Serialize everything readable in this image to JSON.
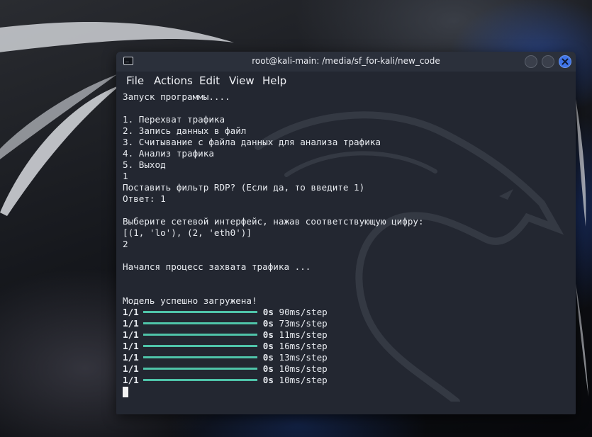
{
  "window": {
    "title": "root@kali-main: /media/sf_for-kali/new_code",
    "app_icon": "terminal-icon"
  },
  "menu": [
    "File",
    "Actions",
    "Edit",
    "View",
    "Help"
  ],
  "terminal": {
    "lines": [
      "Запуск программы....",
      "",
      "1. Перехват трафика",
      "2. Запись данных в файл",
      "3. Считывание с файла данных для анализа трафика",
      "4. Анализ трафика",
      "5. Выход",
      "1",
      "Поставить фильтр RDP? (Если да, то введите 1)",
      "Ответ: 1",
      "",
      "Выберите сетевой интерфейс, нажав соответствующую цифру:",
      "[(1, 'lo'), (2, 'eth0')]",
      "2",
      "",
      "Начался процесс захвата трафика ...",
      "",
      "",
      "Модель успешно загружена!"
    ],
    "progress": [
      {
        "step": "1/1",
        "time": "0s",
        "rate": "90ms/step"
      },
      {
        "step": "1/1",
        "time": "0s",
        "rate": "73ms/step"
      },
      {
        "step": "1/1",
        "time": "0s",
        "rate": "11ms/step"
      },
      {
        "step": "1/1",
        "time": "0s",
        "rate": "16ms/step"
      },
      {
        "step": "1/1",
        "time": "0s",
        "rate": "13ms/step"
      },
      {
        "step": "1/1",
        "time": "0s",
        "rate": "10ms/step"
      },
      {
        "step": "1/1",
        "time": "0s",
        "rate": "10ms/step"
      }
    ],
    "progress_fill": 1.0,
    "colors": {
      "background": "#232731",
      "text": "#e8ebf0",
      "progress_bar": "#4fc4a9",
      "close_button": "#3f74e8"
    }
  }
}
